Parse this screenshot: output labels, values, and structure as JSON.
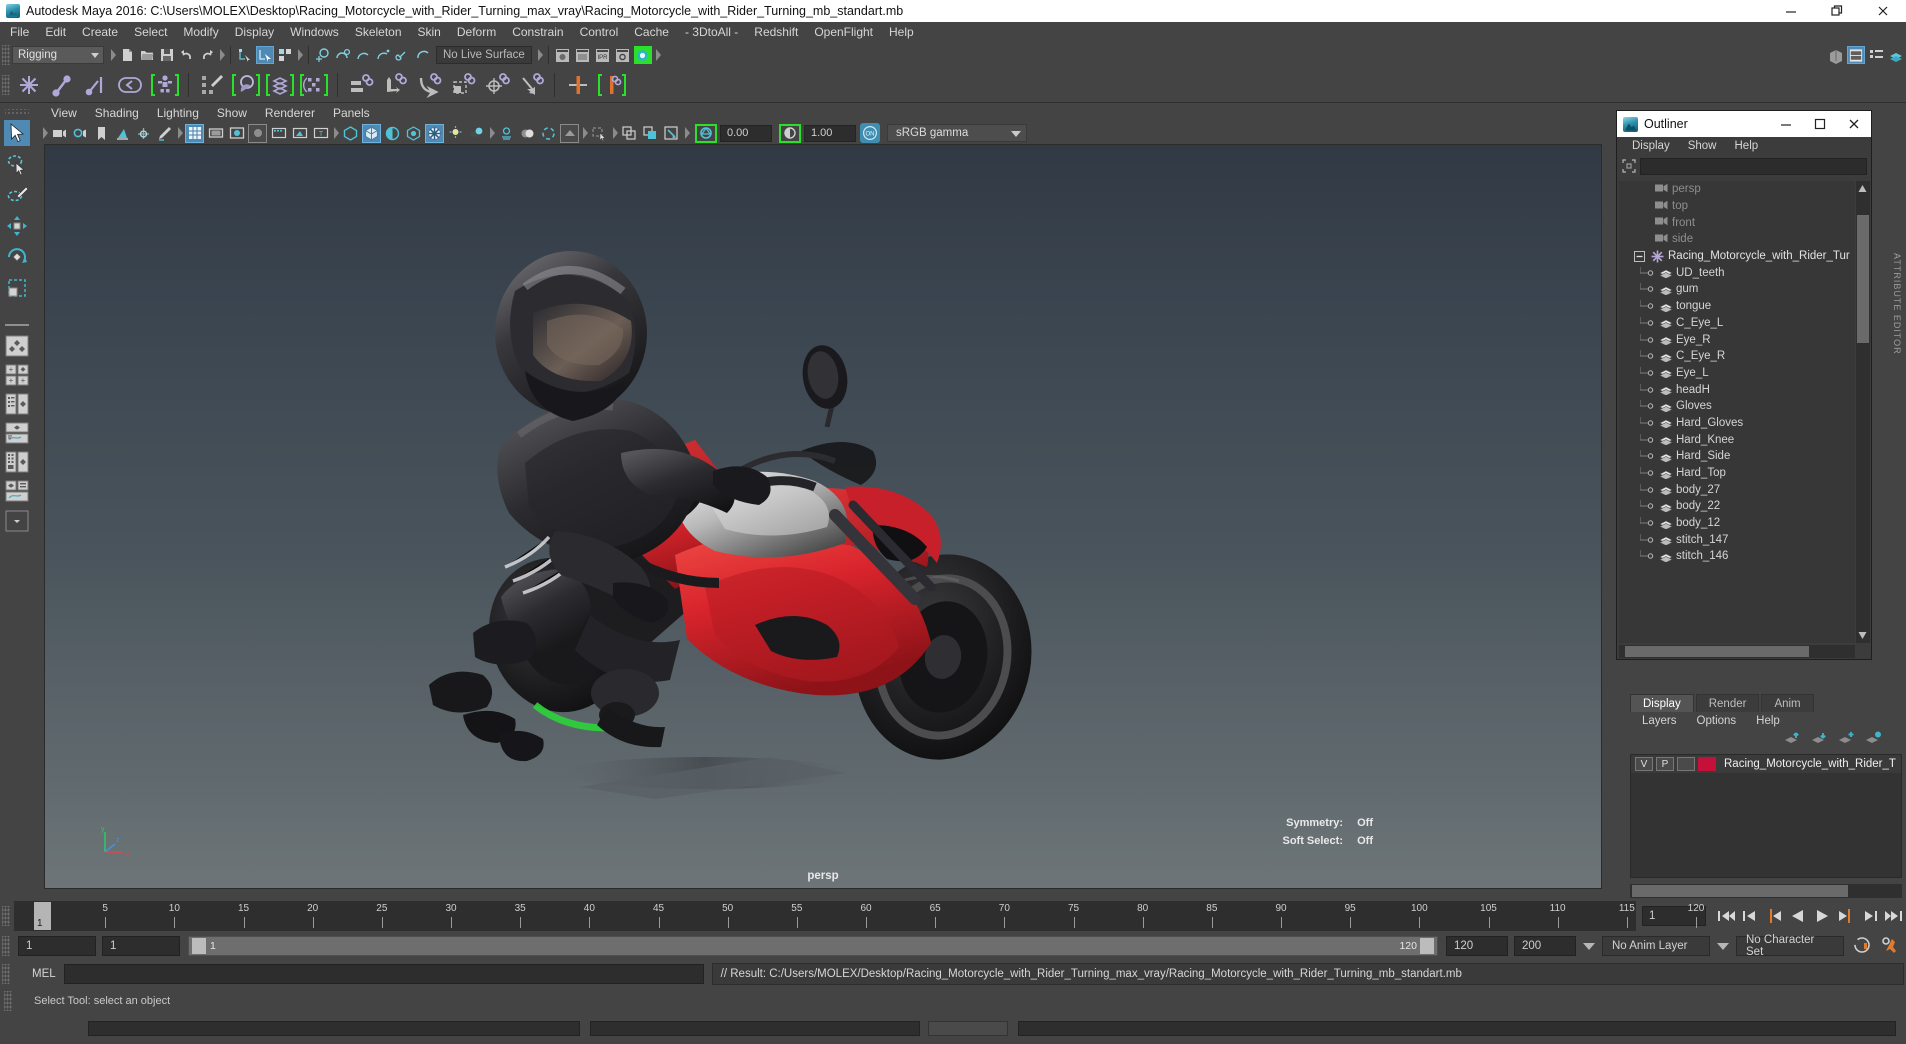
{
  "window": {
    "title": "Autodesk Maya 2016: C:\\Users\\MOLEX\\Desktop\\Racing_Motorcycle_with_Rider_Turning_max_vray\\Racing_Motorcycle_with_Rider_Turning_mb_standart.mb",
    "minimize": "–",
    "restore": "❐",
    "close": "✕"
  },
  "menubar": {
    "items": [
      "File",
      "Edit",
      "Create",
      "Select",
      "Modify",
      "Display",
      "Windows",
      "Skeleton",
      "Skin",
      "Deform",
      "Constrain",
      "Control",
      "Cache",
      "- 3DtoAll -",
      "Redshift",
      "OpenFlight",
      "Help"
    ]
  },
  "statusline": {
    "menuset": "Rigging",
    "live_surface": "No Live Surface"
  },
  "viewport_panel": {
    "menus": [
      "View",
      "Shading",
      "Lighting",
      "Show",
      "Renderer",
      "Panels"
    ],
    "exposure_value": "0.00",
    "gamma_value": "1.00",
    "color_management": "sRGB gamma",
    "camera_label": "persp",
    "symmetry_label": "Symmetry:",
    "symmetry_value": "Off",
    "softselect_label": "Soft Select:",
    "softselect_value": "Off",
    "axis_x": "x",
    "axis_y": "y",
    "axis_z": "z"
  },
  "outliner": {
    "title": "Outliner",
    "minimize": "–",
    "maximize": "❐",
    "close": "✕",
    "menus": [
      "Display",
      "Show",
      "Help"
    ],
    "search_value": "",
    "search_placeholder": "",
    "root_node": "Racing_Motorcycle_with_Rider_Tur",
    "cameras": [
      "persp",
      "top",
      "front",
      "side"
    ],
    "children": [
      "UD_teeth",
      "gum",
      "tongue",
      "C_Eye_L",
      "Eye_R",
      "C_Eye_R",
      "Eye_L",
      "headH",
      "Gloves",
      "Hard_Gloves",
      "Hard_Knee",
      "Hard_Side",
      "Hard_Top",
      "body_27",
      "body_22",
      "body_12",
      "stitch_147",
      "stitch_146"
    ]
  },
  "layer_editor": {
    "tabs": [
      "Display",
      "Render",
      "Anim"
    ],
    "active_tab": "Display",
    "menus": [
      "Layers",
      "Options",
      "Help"
    ],
    "row": {
      "visibility": "V",
      "playback": "P",
      "shading": "",
      "color": "#c5103a",
      "name": "Racing_Motorcycle_with_Rider_T"
    }
  },
  "timeline": {
    "current_frame": "1",
    "ticks": [
      5,
      10,
      15,
      20,
      25,
      30,
      35,
      40,
      45,
      50,
      55,
      60,
      65,
      70,
      75,
      80,
      85,
      90,
      95,
      100,
      105,
      110,
      115,
      120
    ],
    "cursor_frame": "1",
    "range_start": "1",
    "range_end": "1",
    "playback_start": "1",
    "playback_end": "120",
    "anim_start": "120",
    "anim_end": "200",
    "anim_layer": "No Anim Layer",
    "character_set": "No Character Set"
  },
  "command_line": {
    "label": "MEL",
    "input_value": "",
    "result": "// Result: C:/Users/MOLEX/Desktop/Racing_Motorcycle_with_Rider_Turning_max_vray/Racing_Motorcycle_with_Rider_Turning_mb_standart.mb"
  },
  "status_bar": {
    "help_text": "Select Tool: select an object"
  },
  "colors": {
    "accent": "#4f8ab5",
    "highlight_green": "#2ae02a",
    "bike_red": "#d8242c",
    "layer_color": "#c5103a"
  }
}
